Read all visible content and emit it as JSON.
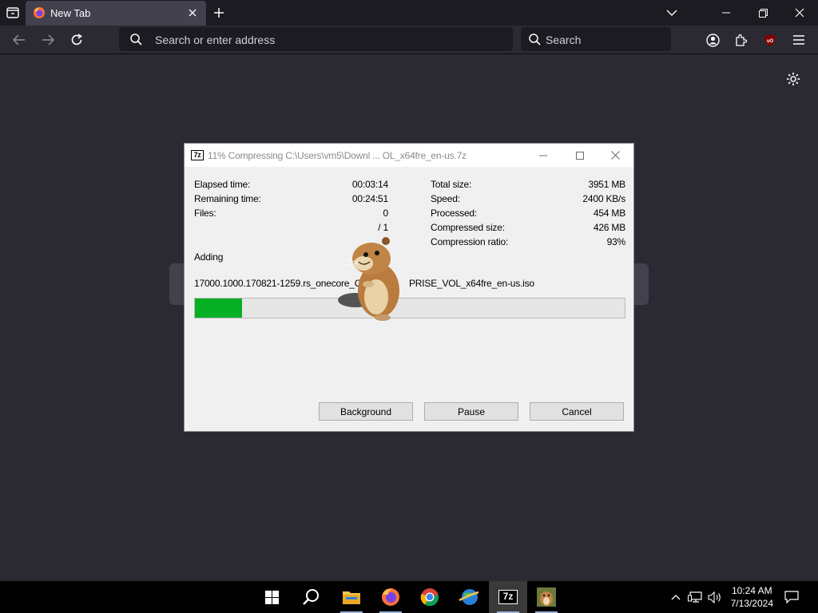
{
  "browser": {
    "tab_title": "New Tab",
    "url_placeholder": "Search or enter address",
    "search_placeholder": "Search"
  },
  "dialog": {
    "title": "11% Compressing C:\\Users\\vm5\\Downl ... OL_x64fre_en-us.7z",
    "icon_text": "7z",
    "left_stats": [
      {
        "label": "Elapsed time:",
        "value": "00:03:14"
      },
      {
        "label": "Remaining time:",
        "value": "00:24:51"
      },
      {
        "label": "Files:",
        "value": "0"
      },
      {
        "label": "",
        "value": "/ 1"
      }
    ],
    "right_stats": [
      {
        "label": "Total size:",
        "value": "3951 MB"
      },
      {
        "label": "Speed:",
        "value": "2400 KB/s"
      },
      {
        "label": "Processed:",
        "value": "454 MB"
      },
      {
        "label": "Compressed size:",
        "value": "426 MB"
      },
      {
        "label": "Compression ratio:",
        "value": "93%"
      }
    ],
    "action": "Adding",
    "current_file_start": "17000.1000.170821-1259.rs_onecore_CLI",
    "current_file_end": "PRISE_VOL_x64fre_en-us.iso",
    "progress_fraction": 0.11,
    "buttons": {
      "background": "Background",
      "pause": "Pause",
      "cancel": "Cancel"
    }
  },
  "taskbar": {
    "time": "10:24 AM",
    "date": "7/13/2024",
    "sevenzip_icon_text": "7z"
  },
  "colors": {
    "progress_fill": "#06b025",
    "browser_bg": "#2b2a33",
    "tabbar_bg": "#1c1b22"
  }
}
